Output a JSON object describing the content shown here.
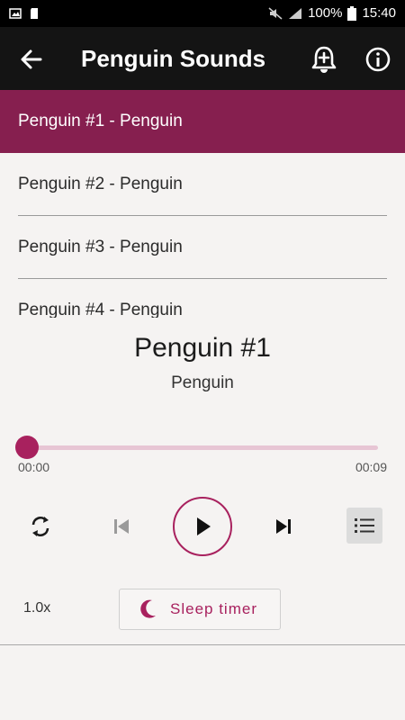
{
  "status_bar": {
    "battery": "100%",
    "time": "15:40"
  },
  "app_bar": {
    "title": "Penguin Sounds",
    "back_icon": "arrow-left-icon",
    "alarm_icon": "alarm-add-icon",
    "info_icon": "info-icon"
  },
  "playlist": {
    "items": [
      {
        "label": "Penguin #1 - Penguin",
        "selected": true
      },
      {
        "label": "Penguin #2 - Penguin",
        "selected": false
      },
      {
        "label": "Penguin #3 - Penguin",
        "selected": false
      },
      {
        "label": "Penguin #4 - Penguin",
        "selected": false
      }
    ]
  },
  "now_playing": {
    "title": "Penguin #1",
    "subtitle": "Penguin"
  },
  "progress": {
    "current": "00:00",
    "total": "00:09",
    "fraction": 0.0
  },
  "controls": {
    "speed": "1.0x",
    "sleep_label": "Sleep timer"
  },
  "colors": {
    "accent": "#a8215e",
    "selected_row": "#861f4f",
    "app_bar": "#141414"
  }
}
